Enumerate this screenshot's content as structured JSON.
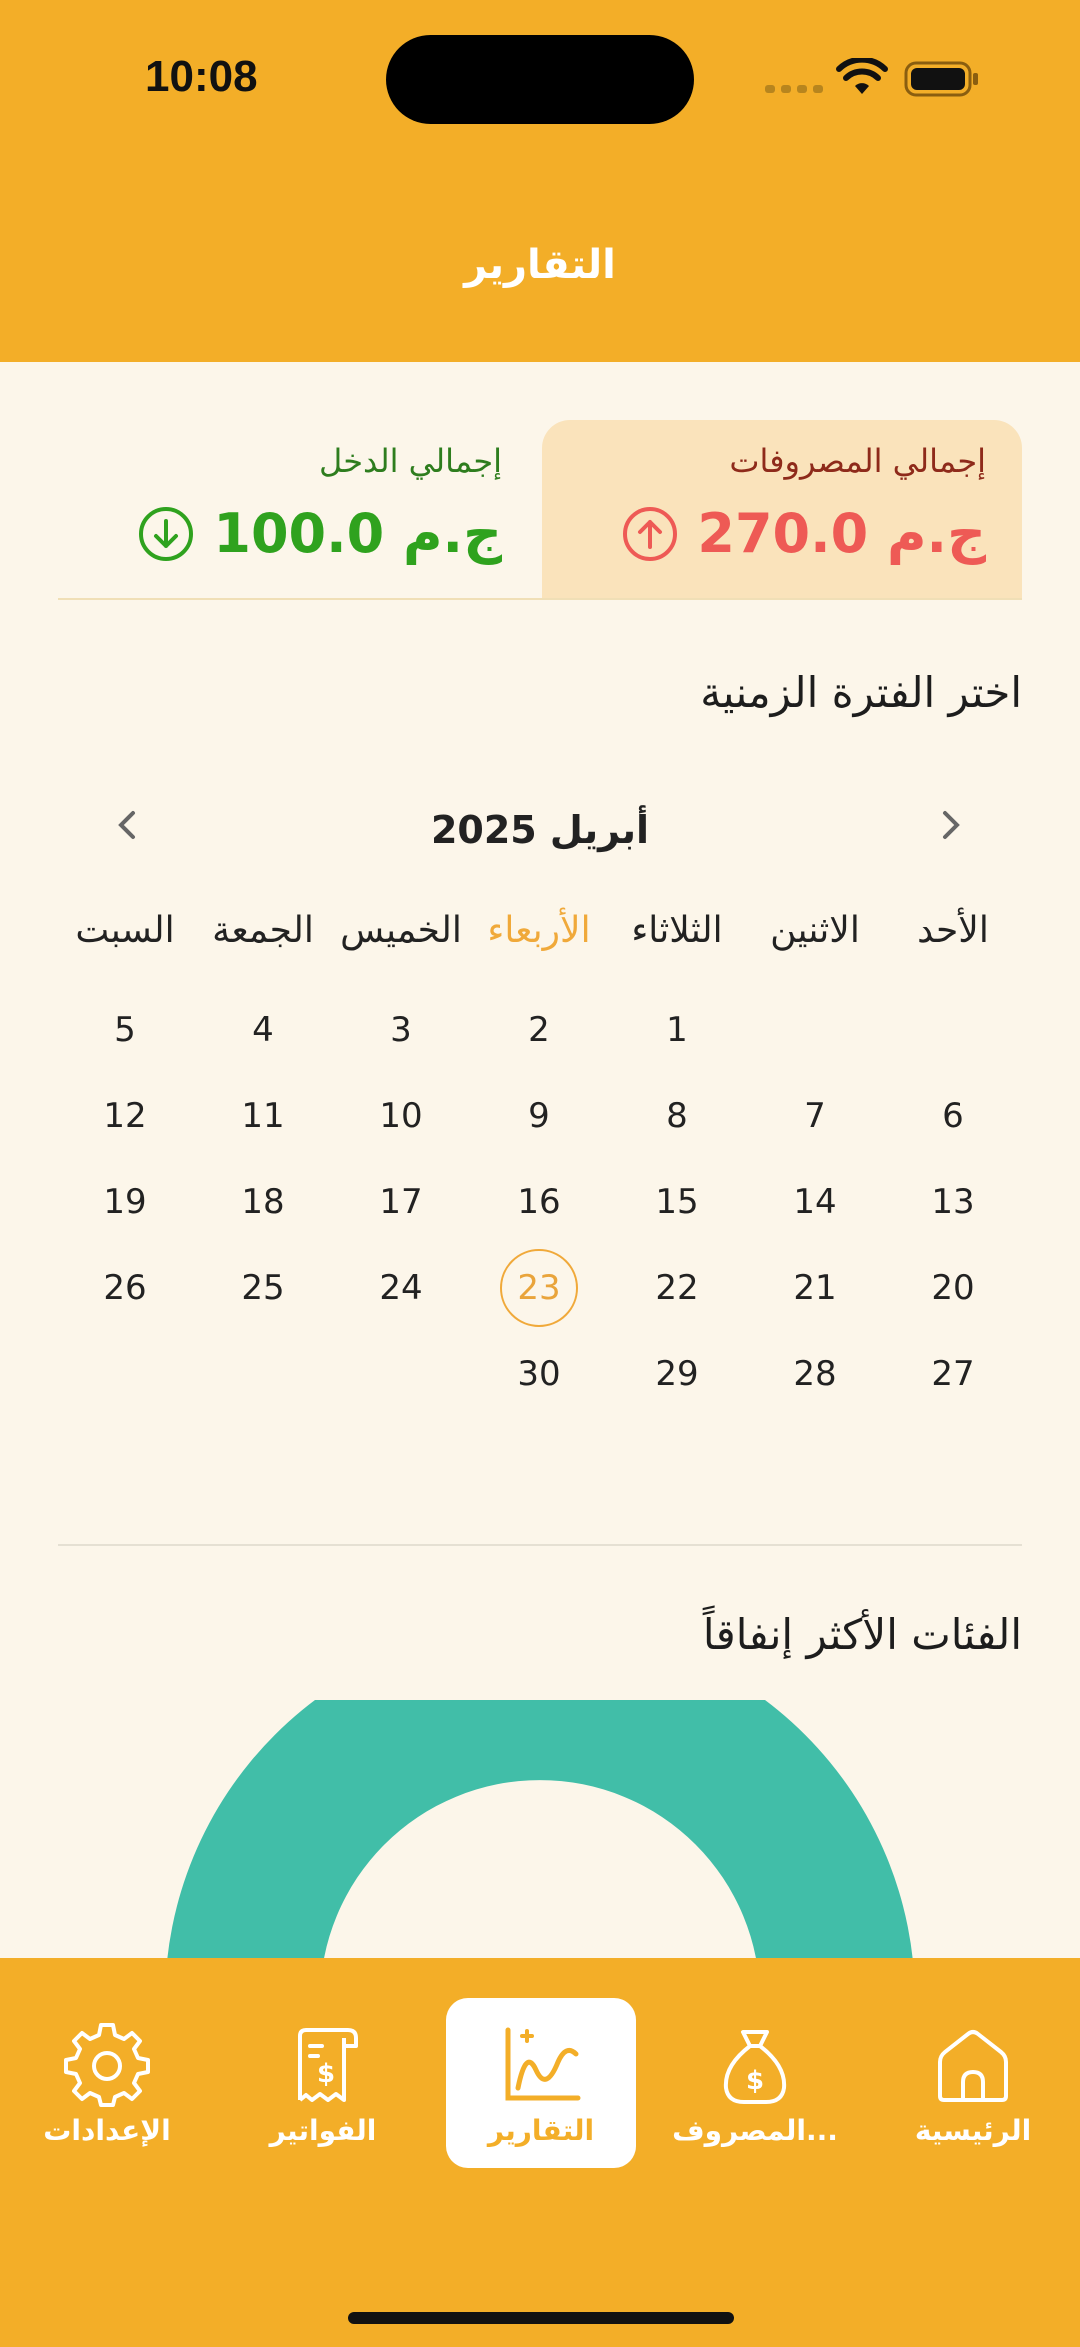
{
  "status_bar": {
    "time": "10:08"
  },
  "header": {
    "title": "التقارير"
  },
  "summary": {
    "expenses": {
      "label": "إجمالي المصروفات",
      "amount": "270.0 ج.م",
      "color": "#EE5A55"
    },
    "income": {
      "label": "إجمالي الدخل",
      "amount": "100.0 ج.م",
      "color": "#2FA21E"
    }
  },
  "period_section": {
    "title": "اختر الفترة الزمنية"
  },
  "calendar": {
    "month_label": "أبريل 2025",
    "weekdays": [
      "الأحد",
      "الاثنين",
      "الثلاثاء",
      "الأربعاء",
      "الخميس",
      "الجمعة",
      "السبت"
    ],
    "active_weekday_index": 3,
    "weeks": [
      [
        "",
        "",
        "1",
        "2",
        "3",
        "4",
        "5"
      ],
      [
        "6",
        "7",
        "8",
        "9",
        "10",
        "11",
        "12"
      ],
      [
        "13",
        "14",
        "15",
        "16",
        "17",
        "18",
        "19"
      ],
      [
        "20",
        "21",
        "22",
        "23",
        "24",
        "25",
        "26"
      ],
      [
        "27",
        "28",
        "29",
        "30",
        "",
        "",
        ""
      ]
    ],
    "selected_day": "23",
    "accent_color": "#F0A93A"
  },
  "categories_section": {
    "title": "الفئات الأكثر إنفاقاً",
    "chart_color": "#41BEA8"
  },
  "bottom_nav": {
    "items": [
      {
        "label": "الرئيسية",
        "icon": "home-icon"
      },
      {
        "label": "المصروف...",
        "icon": "money-bag-icon"
      },
      {
        "label": "التقارير",
        "icon": "chart-icon",
        "active": true
      },
      {
        "label": "الفواتير",
        "icon": "receipt-icon"
      },
      {
        "label": "الإعدادات",
        "icon": "gear-icon"
      }
    ],
    "background_color": "#F3AE28"
  }
}
